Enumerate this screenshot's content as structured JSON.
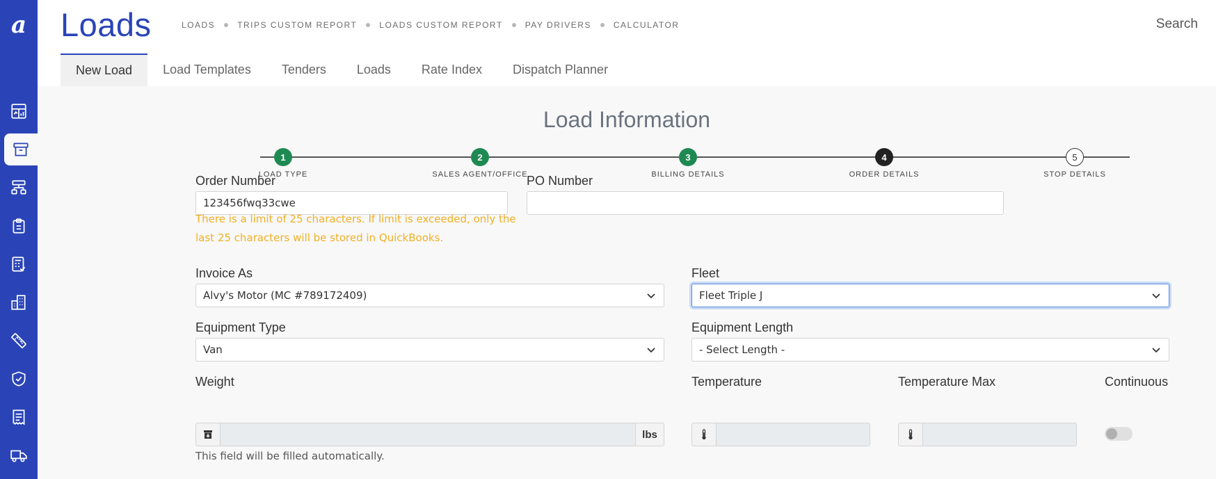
{
  "sidebar": {
    "logo": "a",
    "items": [
      {
        "icon": "dashboard-icon"
      },
      {
        "icon": "archive-box-icon",
        "active": true
      },
      {
        "icon": "hierarchy-icon"
      },
      {
        "icon": "clipboard-icon"
      },
      {
        "icon": "calculator-check-icon"
      },
      {
        "icon": "buildings-icon"
      },
      {
        "icon": "ruler-icon"
      },
      {
        "icon": "shield-check-icon"
      },
      {
        "icon": "receipt-icon"
      },
      {
        "icon": "truck-icon"
      }
    ]
  },
  "header": {
    "title": "Loads",
    "nav": [
      "LOADS",
      "TRIPS CUSTOM REPORT",
      "LOADS CUSTOM REPORT",
      "PAY DRIVERS",
      "CALCULATOR"
    ],
    "search": "Search"
  },
  "tabs": [
    "New Load",
    "Load Templates",
    "Tenders",
    "Loads",
    "Rate Index",
    "Dispatch Planner"
  ],
  "main": {
    "title": "Load Information",
    "steps": [
      {
        "num": "1",
        "label": "LOAD TYPE",
        "state": "done"
      },
      {
        "num": "2",
        "label": "SALES AGENT/OFFICE",
        "state": "done"
      },
      {
        "num": "3",
        "label": "BILLING DETAILS",
        "state": "done"
      },
      {
        "num": "4",
        "label": "ORDER DETAILS",
        "state": "current"
      },
      {
        "num": "5",
        "label": "STOP DETAILS",
        "state": "todo"
      }
    ]
  },
  "form": {
    "order_number": {
      "label": "Order Number",
      "value": "123456fwq33cwe"
    },
    "order_warning_1": "There is a limit of 25 characters. If limit is exceeded, only the",
    "order_warning_2": "last 25 characters will be stored in QuickBooks.",
    "po_number": {
      "label": "PO Number",
      "value": ""
    },
    "invoice_as": {
      "label": "Invoice As",
      "value": "Alvy's Motor (MC #789172409)"
    },
    "fleet": {
      "label": "Fleet",
      "value": "Fleet Triple J"
    },
    "equipment_type": {
      "label": "Equipment Type",
      "value": "Van"
    },
    "equipment_length": {
      "label": "Equipment Length",
      "value": "- Select Length -"
    },
    "weight": {
      "label": "Weight",
      "unit": "lbs",
      "hint": "This field will be filled automatically."
    },
    "temperature": {
      "label": "Temperature"
    },
    "temperature_max": {
      "label": "Temperature Max"
    },
    "continuous": {
      "label": "Continuous",
      "on": false
    }
  },
  "colors": {
    "brand": "#2a44b8",
    "step_done": "#1e8a52",
    "step_current": "#222222",
    "warning": "#f0b024"
  }
}
